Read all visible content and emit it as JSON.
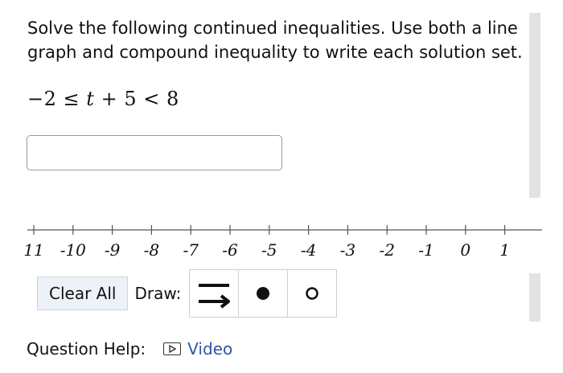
{
  "question": {
    "text": "Solve the following continued inequalities. Use both a line graph and compound inequality to write each solution set.",
    "expression": {
      "lhs": "−2",
      "op1": "≤",
      "var": "t",
      "plus": "+",
      "const": "5",
      "op2": "<",
      "rhs": "8"
    }
  },
  "answer_input": {
    "value": ""
  },
  "number_line": {
    "tick_labels": [
      "11",
      "-10",
      "-9",
      "-8",
      "-7",
      "-6",
      "-5",
      "-4",
      "-3",
      "-2",
      "-1",
      "0",
      "1"
    ]
  },
  "toolbar": {
    "clear_label": "Clear All",
    "draw_label": "Draw:",
    "tools": [
      "ray-tool-icon",
      "closed-dot-icon",
      "open-dot-icon"
    ]
  },
  "help": {
    "label": "Question Help:",
    "video_label": "Video"
  }
}
